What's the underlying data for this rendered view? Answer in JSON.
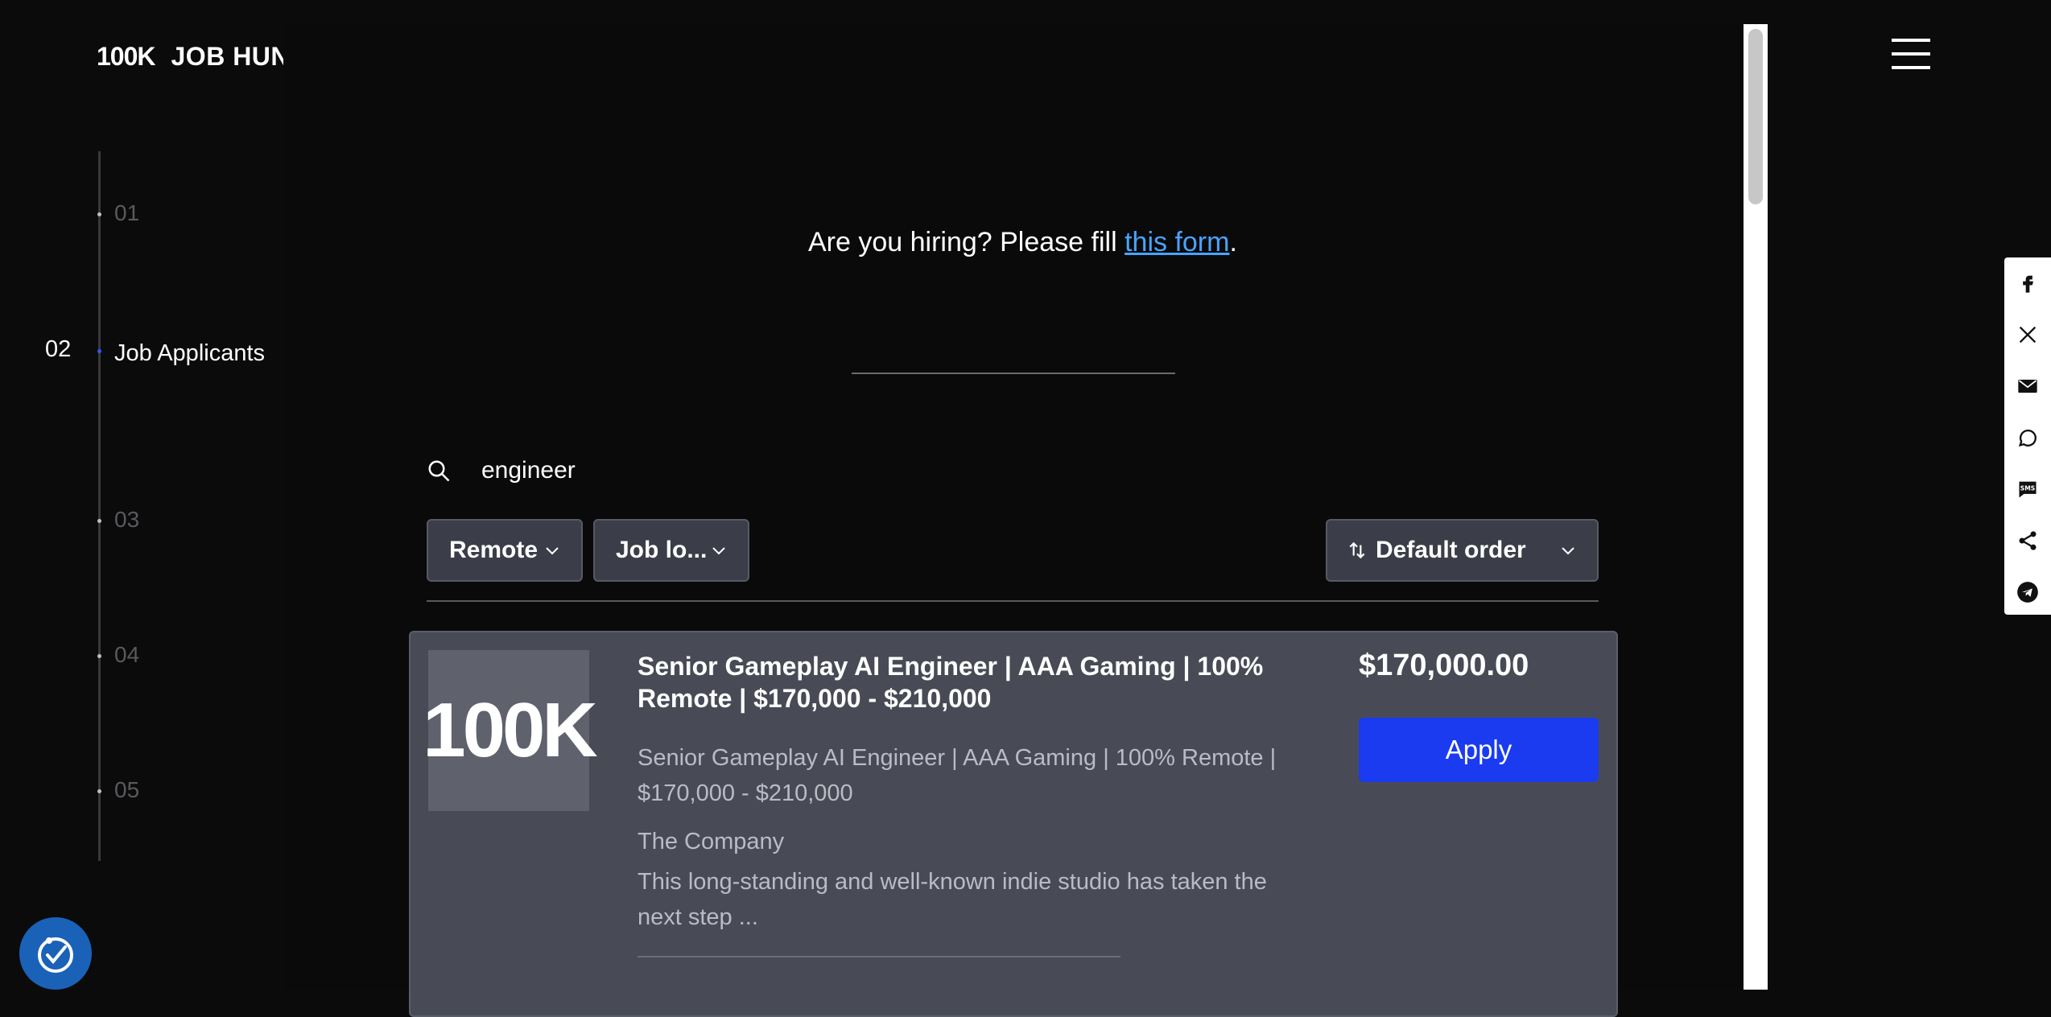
{
  "header": {
    "logo_mark": "100K",
    "logo_text": "JOB HUNT"
  },
  "sidebar": {
    "steps": [
      {
        "num": "01"
      },
      {
        "num": "02",
        "label": "Job Applicants"
      },
      {
        "num": "03"
      },
      {
        "num": "04"
      },
      {
        "num": "05"
      }
    ]
  },
  "hiring": {
    "prefix": "Are you hiring? Please fill ",
    "link": "this form",
    "suffix": "."
  },
  "search": {
    "value": "engineer"
  },
  "filters": {
    "remote": "Remote",
    "location": "Job lo...",
    "order": "Default order"
  },
  "job": {
    "thumb": "100K",
    "title": "Senior Gameplay AI Engineer | AAA Gaming | 100% Remote | $170,000 - $210,000",
    "subtitle": "Senior Gameplay AI Engineer | AAA Gaming | 100% Remote | $170,000 - $210,000",
    "company": "The Company",
    "description": "This long-standing and well-known indie studio has taken the next step ...",
    "salary": "$170,000.00",
    "apply": "Apply"
  },
  "share": [
    "facebook-icon",
    "x-icon",
    "email-icon",
    "whatsapp-icon",
    "sms-icon",
    "share-icon",
    "telegram-icon"
  ],
  "colors": {
    "accent": "#1a3bef",
    "link": "#4aa3ff",
    "card": "#484b56",
    "background": "#0b0b0c"
  }
}
